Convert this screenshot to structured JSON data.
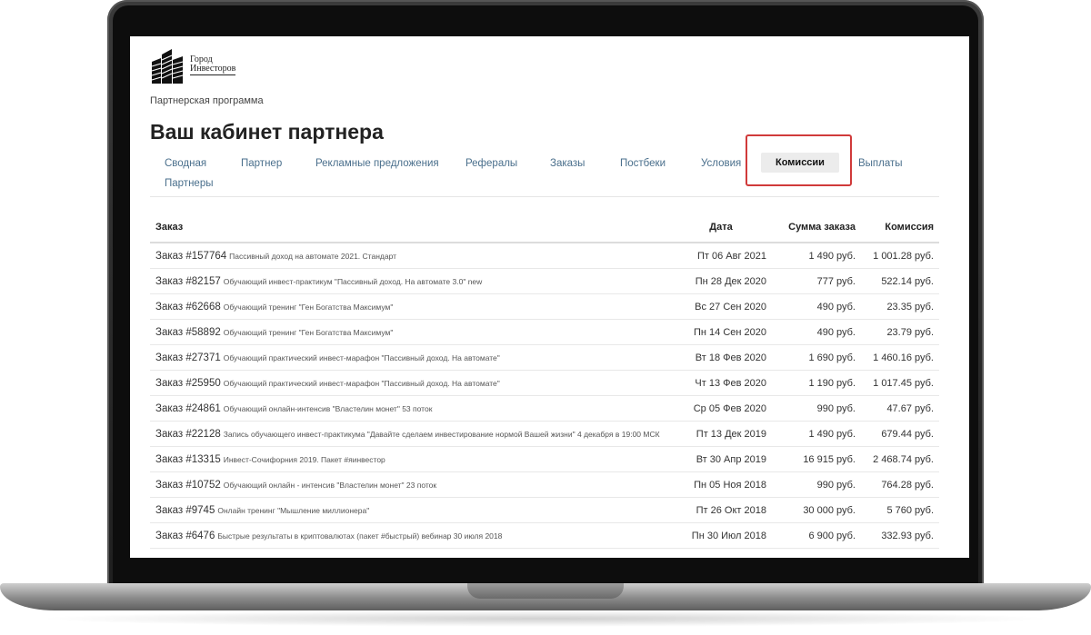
{
  "logo": {
    "line1": "Город",
    "line2": "Инвесторов"
  },
  "breadcrumb": "Партнерская программа",
  "page_title": "Ваш кабинет партнера",
  "tabs": [
    {
      "label": "Сводная"
    },
    {
      "label": "Партнер"
    },
    {
      "label": "Рекламные предложения"
    },
    {
      "label": "Рефералы"
    },
    {
      "label": "Заказы"
    },
    {
      "label": "Постбеки"
    },
    {
      "label": "Условия"
    },
    {
      "label": "Комиссии",
      "active": true
    },
    {
      "label": "Выплаты"
    },
    {
      "label": "Партнеры"
    }
  ],
  "table": {
    "headers": {
      "order": "Заказ",
      "date": "Дата",
      "sum": "Сумма заказа",
      "commission": "Комиссия"
    },
    "rows": [
      {
        "order": "Заказ #157764",
        "desc": "Пассивный доход на автомате 2021. Стандарт",
        "date": "Пт 06 Авг 2021",
        "sum": "1 490 руб.",
        "commission": "1 001.28 руб."
      },
      {
        "order": "Заказ #82157",
        "desc": "Обучающий инвест-практикум \"Пассивный доход. На автомате 3.0\" new",
        "date": "Пн 28 Дек 2020",
        "sum": "777 руб.",
        "commission": "522.14 руб."
      },
      {
        "order": "Заказ #62668",
        "desc": "Обучающий тренинг \"Ген Богатства Максимум\"",
        "date": "Вс 27 Сен 2020",
        "sum": "490 руб.",
        "commission": "23.35 руб."
      },
      {
        "order": "Заказ #58892",
        "desc": "Обучающий тренинг \"Ген Богатства Максимум\"",
        "date": "Пн 14 Сен 2020",
        "sum": "490 руб.",
        "commission": "23.79 руб."
      },
      {
        "order": "Заказ #27371",
        "desc": "Обучающий практический инвест-марафон \"Пассивный доход. На автомате\"",
        "date": "Вт 18 Фев 2020",
        "sum": "1 690 руб.",
        "commission": "1 460.16 руб."
      },
      {
        "order": "Заказ #25950",
        "desc": "Обучающий практический инвест-марафон \"Пассивный доход. На автомате\"",
        "date": "Чт 13 Фев 2020",
        "sum": "1 190 руб.",
        "commission": "1 017.45 руб."
      },
      {
        "order": "Заказ #24861",
        "desc": "Обучающий онлайн-интенсив \"Властелин монет\" 53 поток",
        "date": "Ср 05 Фев 2020",
        "sum": "990 руб.",
        "commission": "47.67 руб."
      },
      {
        "order": "Заказ #22128",
        "desc": "Запись обучающего инвест-практикума \"Давайте сделаем инвестирование нормой Вашей жизни\" 4 декабря в 19:00 МСК",
        "date": "Пт 13 Дек 2019",
        "sum": "1 490 руб.",
        "commission": "679.44 руб."
      },
      {
        "order": "Заказ #13315",
        "desc": "Инвест-Сочифорния 2019. Пакет #яинвестор",
        "date": "Вт 30 Апр 2019",
        "sum": "16 915 руб.",
        "commission": "2 468.74 руб."
      },
      {
        "order": "Заказ #10752",
        "desc": "Обучающий онлайн - интенсив \"Властелин монет\" 23 поток",
        "date": "Пн 05 Ноя 2018",
        "sum": "990 руб.",
        "commission": "764.28 руб."
      },
      {
        "order": "Заказ #9745",
        "desc": "Онлайн тренинг \"Мышление миллионера\"",
        "date": "Пт 26 Окт 2018",
        "sum": "30 000 руб.",
        "commission": "5 760 руб."
      },
      {
        "order": "Заказ #6476",
        "desc": "Быстрые результаты в криптовалютах (пакет #быстрый) вебинар 30 июля 2018",
        "date": "Пн 30 Июл 2018",
        "sum": "6 900 руб.",
        "commission": "332.93 руб."
      }
    ]
  },
  "colors": {
    "tab_link": "#4a6f8c",
    "highlight": "#d03a3a",
    "active_tab_bg": "#ececec"
  }
}
